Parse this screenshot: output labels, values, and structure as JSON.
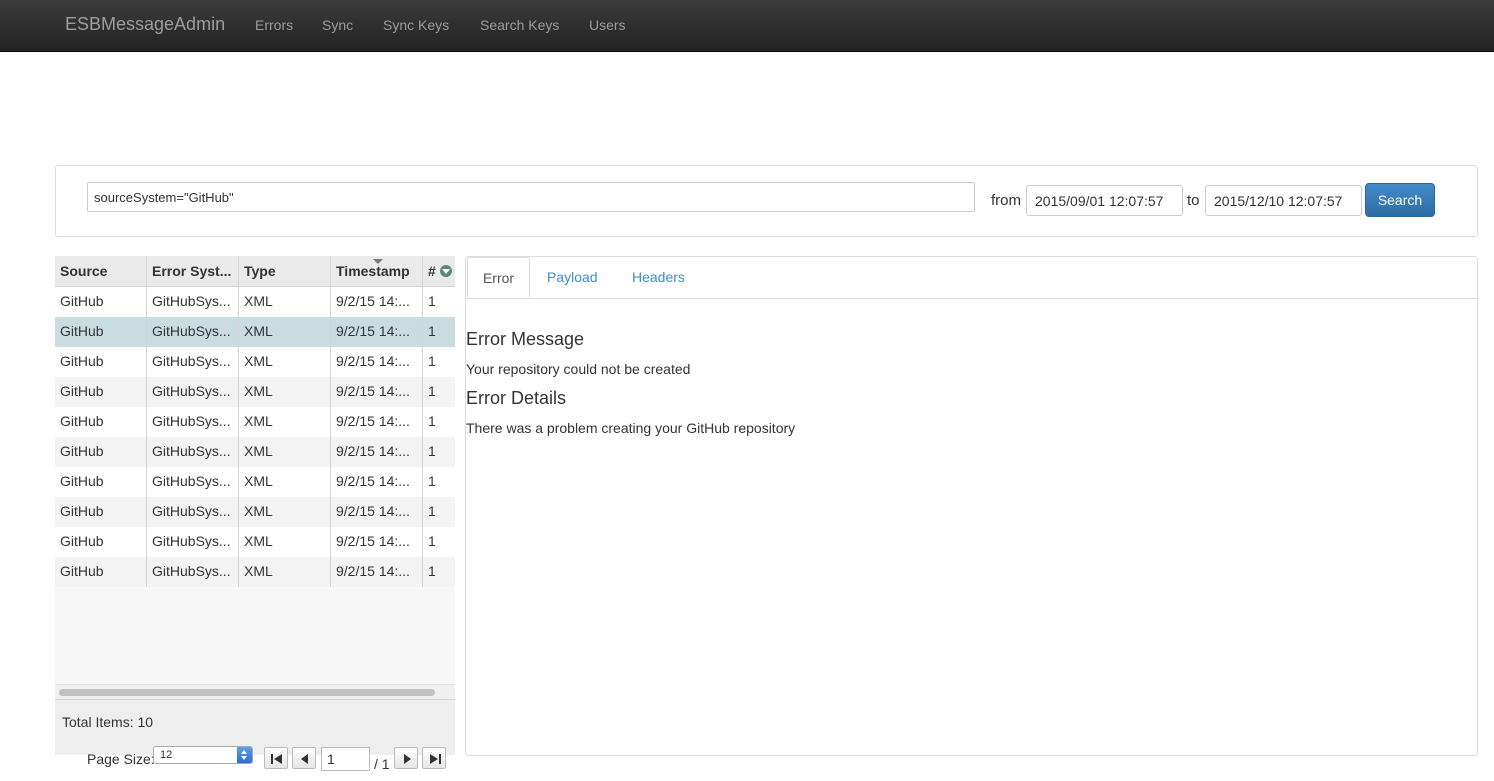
{
  "navbar": {
    "brand": "ESBMessageAdmin",
    "links": [
      "Errors",
      "Sync",
      "Sync Keys",
      "Search Keys",
      "Users"
    ]
  },
  "search": {
    "query": "sourceSystem=\"GitHub\"",
    "from_label": "from",
    "from_value": "2015/09/01 12:07:57",
    "to_label": "to",
    "to_value": "2015/12/10 12:07:57",
    "button": "Search"
  },
  "grid": {
    "columns": [
      "Source",
      "Error Syst...",
      "Type",
      "Timestamp",
      "#"
    ],
    "rows": [
      [
        "GitHub",
        "GitHubSys...",
        "XML",
        "9/2/15 14:...",
        "1"
      ],
      [
        "GitHub",
        "GitHubSys...",
        "XML",
        "9/2/15 14:...",
        "1"
      ],
      [
        "GitHub",
        "GitHubSys...",
        "XML",
        "9/2/15 14:...",
        "1"
      ],
      [
        "GitHub",
        "GitHubSys...",
        "XML",
        "9/2/15 14:...",
        "1"
      ],
      [
        "GitHub",
        "GitHubSys...",
        "XML",
        "9/2/15 14:...",
        "1"
      ],
      [
        "GitHub",
        "GitHubSys...",
        "XML",
        "9/2/15 14:...",
        "1"
      ],
      [
        "GitHub",
        "GitHubSys...",
        "XML",
        "9/2/15 14:...",
        "1"
      ],
      [
        "GitHub",
        "GitHubSys...",
        "XML",
        "9/2/15 14:...",
        "1"
      ],
      [
        "GitHub",
        "GitHubSys...",
        "XML",
        "9/2/15 14:...",
        "1"
      ],
      [
        "GitHub",
        "GitHubSys...",
        "XML",
        "9/2/15 14:...",
        "1"
      ]
    ],
    "selected_row": 1,
    "total_items": "Total Items: 10"
  },
  "pager": {
    "page_size_label": "Page Size:",
    "page_size": "12",
    "current_page": "1",
    "of_pages": "/ 1",
    "icons": [
      "first-page-icon",
      "prev-page-icon",
      "next-page-icon",
      "last-page-icon"
    ]
  },
  "detail": {
    "tabs": [
      "Error",
      "Payload",
      "Headers"
    ],
    "active_tab": "Error",
    "error_message_heading": "Error Message",
    "error_message": "Your repository could not be created",
    "error_details_heading": "Error Details",
    "error_details": "There was a problem creating your GitHub repository"
  },
  "colors": {
    "navbar": "#222222",
    "link": "#428bca",
    "primary_button": "#3071a9",
    "selected_row": "#c9dde1"
  }
}
